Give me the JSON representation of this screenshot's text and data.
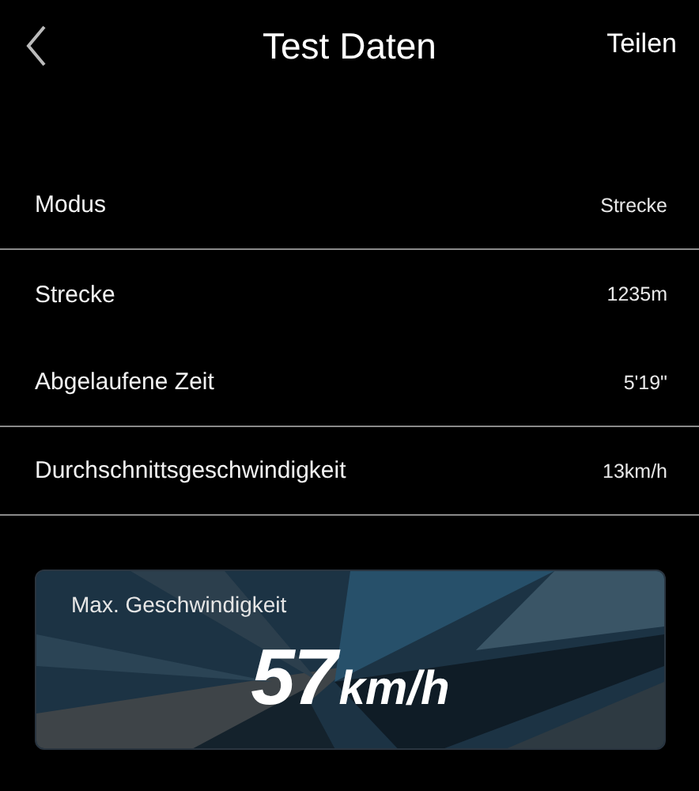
{
  "header": {
    "title": "Test Daten",
    "action": "Teilen"
  },
  "rows": [
    {
      "label": "Modus",
      "value": "Strecke",
      "divider": true
    },
    {
      "label": "Strecke",
      "value": "1235m",
      "divider": false
    },
    {
      "label": "Abgelaufene Zeit",
      "value": "5'19\"",
      "divider": true
    },
    {
      "label": "Durchschnittsgeschwindigkeit",
      "value": "13km/h",
      "divider": true
    }
  ],
  "max_speed": {
    "label": "Max. Geschwindigkeit",
    "value": "57",
    "unit": "km/h"
  }
}
